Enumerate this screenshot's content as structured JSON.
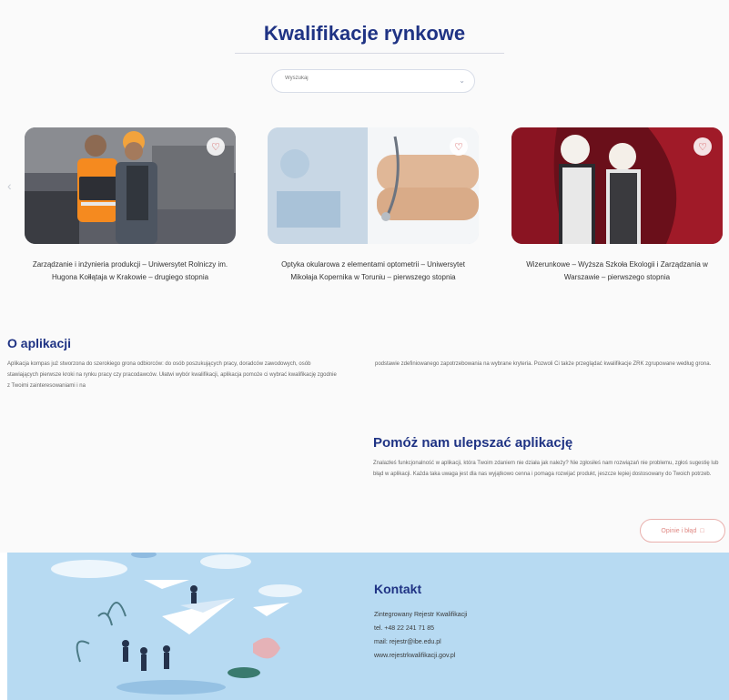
{
  "header": {
    "title": "Kwalifikacje rynkowe"
  },
  "search": {
    "placeholder": "Wyszukaj"
  },
  "carousel": {
    "cards": [
      {
        "caption": "Zarządzanie i inżynieria produkcji – Uniwersytet Rolniczy im. Hugona Kołłątaja w Krakowie – drugiego stopnia",
        "image": "workers-photo"
      },
      {
        "caption": "Optyka okularowa z elementami optometrii – Uniwersytet Mikołaja Kopernika w Toruniu – pierwszego stopnia",
        "image": "doctor-photo"
      },
      {
        "caption": "Wizerunkowe – Wyższa Szkoła Ekologii i Zarządzania w Warszawie – pierwszego stopnia",
        "image": "mimes-photo"
      }
    ]
  },
  "about": {
    "title": "O aplikacji",
    "text_left": "Aplikacja kompas już stworzona do szerokiego grona odbiorców: do osób poszukujących pracy, doradców zawodowych, osób stawiających pierwsze kroki na rynku pracy czy pracodawców. Ułatwi wybór kwalifikacji, aplikacja pomoże ci wybrać kwalifikację zgodnie z Twoimi zainteresowaniami i na",
    "text_right": "podstawie zdefiniowanego zapotrzebowania na wybrane kryteria. Pozwoli Ci także przeglądać kwalifikacje ZRK zgrupowane według grona."
  },
  "improve": {
    "title": "Pomóż nam ulepszać aplikację",
    "text": "Znalazłeś funkcjonalność w aplikacji, która Twoim zdaniem nie działa jak należy? Nie zgłosiłeś nam rozwiązań nie problemu, zgłoś sugestię lub błąd w aplikacji. Każda taka uwaga jest dla nas wyjątkowo cenna i pomaga rozwijać produkt, jeszcze lepiej dostosowany do Twoich potrzeb.",
    "button_label": "Opinie i błąd",
    "button_icon": "feedback-icon"
  },
  "contact": {
    "title": "Kontakt",
    "lines": [
      "Zintegrowany Rejestr Kwalifikacji",
      "tel. +48 22 241 71 85",
      "mail: rejestr@ibe.edu.pl",
      "www.rejestrkwalifikacji.gov.pl"
    ]
  },
  "colors": {
    "accent": "#1f3384",
    "footer_bg": "#b7daf2",
    "button_border": "#e9b0ad"
  }
}
